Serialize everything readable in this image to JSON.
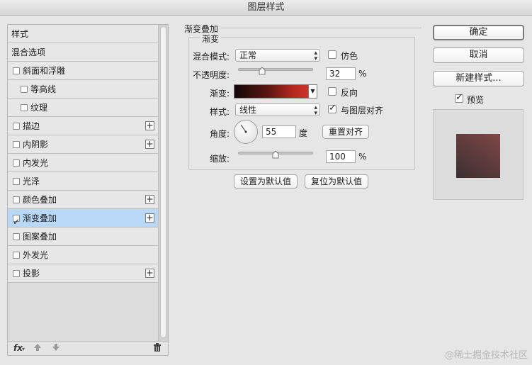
{
  "window": {
    "title": "图层样式"
  },
  "left_panel": {
    "items": [
      {
        "label": "样式",
        "has_checkbox": false,
        "checked": false,
        "has_plus": false,
        "indent": false,
        "selected": false
      },
      {
        "label": "混合选项",
        "has_checkbox": false,
        "checked": false,
        "has_plus": false,
        "indent": false,
        "selected": false
      },
      {
        "label": "斜面和浮雕",
        "has_checkbox": true,
        "checked": false,
        "has_plus": false,
        "indent": false,
        "selected": false
      },
      {
        "label": "等高线",
        "has_checkbox": true,
        "checked": false,
        "has_plus": false,
        "indent": true,
        "selected": false
      },
      {
        "label": "纹理",
        "has_checkbox": true,
        "checked": false,
        "has_plus": false,
        "indent": true,
        "selected": false
      },
      {
        "label": "描边",
        "has_checkbox": true,
        "checked": false,
        "has_plus": true,
        "indent": false,
        "selected": false
      },
      {
        "label": "内阴影",
        "has_checkbox": true,
        "checked": false,
        "has_plus": true,
        "indent": false,
        "selected": false
      },
      {
        "label": "内发光",
        "has_checkbox": true,
        "checked": false,
        "has_plus": false,
        "indent": false,
        "selected": false
      },
      {
        "label": "光泽",
        "has_checkbox": true,
        "checked": false,
        "has_plus": false,
        "indent": false,
        "selected": false
      },
      {
        "label": "颜色叠加",
        "has_checkbox": true,
        "checked": false,
        "has_plus": true,
        "indent": false,
        "selected": false
      },
      {
        "label": "渐变叠加",
        "has_checkbox": true,
        "checked": true,
        "has_plus": true,
        "indent": false,
        "selected": true
      },
      {
        "label": "图案叠加",
        "has_checkbox": true,
        "checked": false,
        "has_plus": false,
        "indent": false,
        "selected": false
      },
      {
        "label": "外发光",
        "has_checkbox": true,
        "checked": false,
        "has_plus": false,
        "indent": false,
        "selected": false
      },
      {
        "label": "投影",
        "has_checkbox": true,
        "checked": false,
        "has_plus": true,
        "indent": false,
        "selected": false
      }
    ],
    "footer": {
      "fx_label": "fx",
      "fx_icon": "fx-icon",
      "up_icon": "arrow-up-icon",
      "down_icon": "arrow-down-icon",
      "trash_icon": "trash-icon"
    }
  },
  "gradient_overlay": {
    "section_title": "渐变叠加",
    "group_title": "渐变",
    "blend_mode_label": "混合模式:",
    "blend_mode_value": "正常",
    "dither_label": "仿色",
    "dither_checked": false,
    "opacity_label": "不透明度:",
    "opacity_value": "32",
    "opacity_level": 0.32,
    "opacity_unit": "%",
    "gradient_label": "渐变:",
    "gradient_colors": [
      "#130808",
      "#5a1512",
      "#b52a20",
      "#cf3327"
    ],
    "reverse_label": "反向",
    "reverse_checked": false,
    "style_label": "样式:",
    "style_value": "线性",
    "align_label": "与图层对齐",
    "align_checked": true,
    "angle_label": "角度:",
    "angle_value": "55",
    "angle_unit": "度",
    "reset_align_button": "重置对齐",
    "scale_label": "缩放:",
    "scale_value": "100",
    "scale_level": 0.5,
    "scale_unit": "%",
    "set_default_button": "设置为默认值",
    "reset_default_button": "复位为默认值"
  },
  "right_panel": {
    "ok_button": "确定",
    "cancel_button": "取消",
    "new_style_button": "新建样式...",
    "preview_label": "预览",
    "preview_checked": true
  },
  "watermark": "@稀土掘金技术社区"
}
